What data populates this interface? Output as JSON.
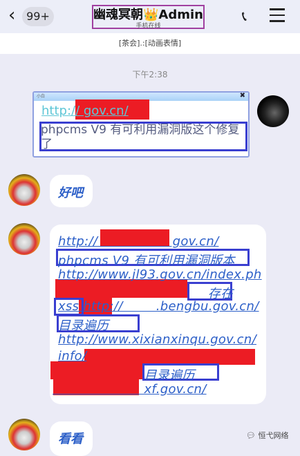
{
  "header": {
    "back_badge": "99+",
    "title": "幽魂冥朝👑Admin",
    "subtitle": "手机在线"
  },
  "notice": "[茶会].:[动画表情]",
  "time": "下午2:38",
  "quoted_card": {
    "label": "小白",
    "link": "http://                 gov.cn/",
    "text": "phpcms V9 有可利用漏洞版这个修复了"
  },
  "messages": [
    {
      "text": "好吧"
    },
    {
      "lines": [
        "http://                  gov.cn/",
        "phpcms V9 有可利用漏洞版本",
        "http://www.jl93.gov.cn/index.ph",
        "                                    存在",
        "xss http://        .bengbu.gov.cn/",
        "目录遍历",
        "http://www.xixianxinqu.gov.cn/",
        "info/",
        "                      目录遍历",
        "                      xf.gov.cn/"
      ]
    },
    {
      "text": "看看"
    }
  ],
  "watermark": "恒弋网络",
  "colors": {
    "highlight_box": "#3a3fd0",
    "redaction": "#ec1c24",
    "link": "#2c5fc8"
  }
}
